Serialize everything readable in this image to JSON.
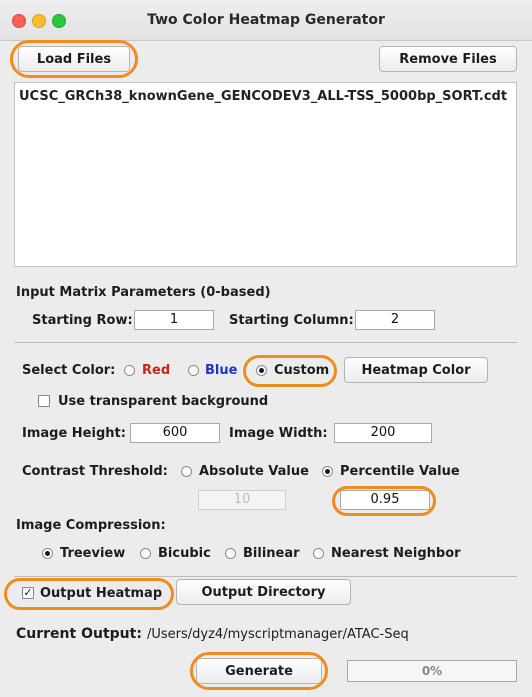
{
  "window": {
    "title": "Two Color Heatmap Generator"
  },
  "files": {
    "load_label": "Load Files",
    "remove_label": "Remove Files",
    "items": [
      "UCSC_GRCh38_knownGene_GENCODEV3_ALL-TSS_5000bp_SORT.cdt"
    ]
  },
  "matrix": {
    "heading": "Input Matrix Parameters (0-based)",
    "start_row_label": "Starting Row:",
    "start_row_value": "1",
    "start_col_label": "Starting Column:",
    "start_col_value": "2"
  },
  "color": {
    "label": "Select Color:",
    "options": [
      {
        "label": "Red",
        "color": "#c8251d",
        "selected": false
      },
      {
        "label": "Blue",
        "color": "#1f36c0",
        "selected": false
      },
      {
        "label": "Custom",
        "color": "#1d1d1d",
        "selected": true
      }
    ],
    "heatmap_color_label": "Heatmap Color",
    "transparent_label": "Use transparent background",
    "transparent_checked": false
  },
  "image": {
    "height_label": "Image Height:",
    "height_value": "600",
    "width_label": "Image Width:",
    "width_value": "200"
  },
  "contrast": {
    "label": "Contrast Threshold:",
    "absolute_label": "Absolute Value",
    "percentile_label": "Percentile Value",
    "selected": "percentile",
    "absolute_value": "10",
    "percentile_value": "0.95"
  },
  "compression": {
    "label": "Image Compression:",
    "options": [
      "Treeview",
      "Bicubic",
      "Bilinear",
      "Nearest Neighbor"
    ],
    "selected": "Treeview"
  },
  "output": {
    "heatmap_label": "Output Heatmap",
    "heatmap_checked": true,
    "directory_label": "Output Directory",
    "current_label": "Current Output:",
    "current_path": "/Users/dyz4/myscriptmanager/ATAC-Seq"
  },
  "generate": {
    "label": "Generate",
    "progress_percent": 0,
    "progress_text": "0%"
  },
  "highlight_color": "#f08c1e"
}
